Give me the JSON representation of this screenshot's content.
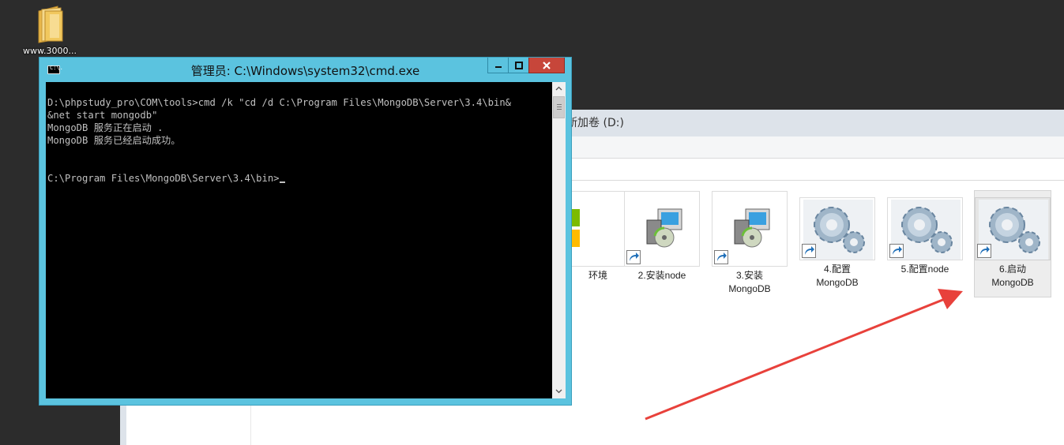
{
  "desktop": {
    "icons": [
      {
        "label": "www.3000...",
        "icon": "folder-icon"
      }
    ]
  },
  "explorer": {
    "title": "新加卷 (D:)",
    "files": [
      {
        "label": "环境",
        "icon": "colored-squares-icon"
      },
      {
        "label": "2.安装node",
        "icon": "installer-icon"
      },
      {
        "label": "3.安装\nMongoDB",
        "icon": "installer-icon"
      },
      {
        "label": "4.配置\nMongoDB",
        "icon": "gears-icon"
      },
      {
        "label": "5.配置node",
        "icon": "gears-icon"
      },
      {
        "label": "6.启动\nMongoDB",
        "icon": "gears-icon",
        "selected": true
      }
    ]
  },
  "cmd": {
    "title": "管理员: C:\\Windows\\system32\\cmd.exe",
    "icon_text": "C:\\.",
    "lines": [
      "D:\\phpstudy_pro\\COM\\tools>cmd /k \"cd /d C:\\Program Files\\MongoDB\\Server\\3.4\\bin&",
      "&net start mongodb\"",
      "MongoDB 服务正在启动 .",
      "MongoDB 服务已经启动成功。",
      "",
      "",
      "C:\\Program Files\\MongoDB\\Server\\3.4\\bin>"
    ],
    "controls": [
      "minimize-icon",
      "maximize-icon",
      "close-icon"
    ]
  },
  "colors": {
    "cmd_frame": "#5bc3df",
    "close_button": "#c7463a",
    "arrow": "#e8413b"
  }
}
